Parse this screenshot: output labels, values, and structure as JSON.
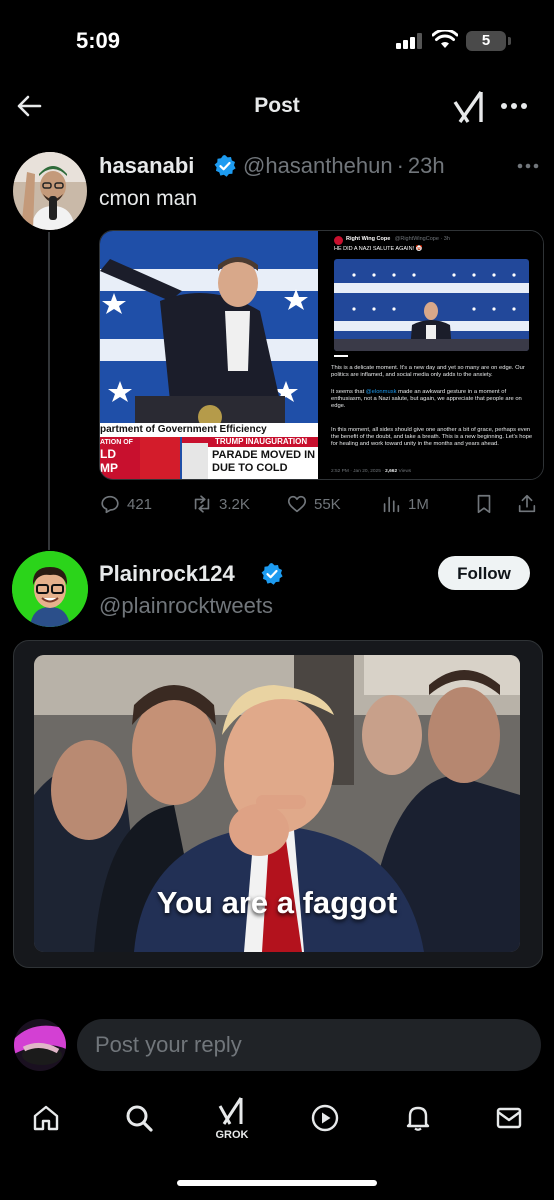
{
  "status": {
    "time": "5:09",
    "battery": "5"
  },
  "header": {
    "title": "Post"
  },
  "post1": {
    "name": "hasanabi",
    "handle": "@hasanthehun",
    "time": "23h",
    "separator": "·",
    "text": "cmon man",
    "media": {
      "chyron_top": "partment of Government Efficiency",
      "chyron_red": "TRUMP INAUGURATION",
      "chyron_main1": "PARADE MOVED IN",
      "chyron_main2": "DUE TO COLD",
      "chyron_left1": "ATION OF",
      "chyron_left2": "LD",
      "chyron_left3": "MP",
      "embed_account": "Right Wing Cope",
      "embed_handle": "@RightWingCope · 3h",
      "embed_title": "HE DID A NAZI SALUTE AGAIN! 🤡",
      "embed_p1": "This is a delicate moment. It's a new day and yet so many are on edge. Our politics are inflamed, and social media only adds to the anxiety.",
      "embed_p2a": "It seems that ",
      "embed_p2_mention": "@elonmusk",
      "embed_p2b": " made an awkward gesture in a moment of enthusiasm, not a Nazi salute, but again, we appreciate that people are on edge.",
      "embed_p3": "In this moment, all sides should give one another a bit of grace, perhaps even the benefit of the doubt, and take a breath. This is a new beginning. Let's hope for healing and work toward unity in the months and years ahead.",
      "embed_footer": "2:52 PM · Jan 20, 2025 · ",
      "embed_views": "2,662",
      "embed_views_label": " Views"
    },
    "actions": {
      "replies": "421",
      "reposts": "3.2K",
      "likes": "55K",
      "views": "1M"
    }
  },
  "post2": {
    "name": "Plainrock124",
    "handle": "@plainrocktweets",
    "follow_label": "Follow",
    "media_caption": "You are a faggot"
  },
  "reply": {
    "placeholder": "Post your reply"
  },
  "tabs": {
    "grok_label": "GROK"
  },
  "colors": {
    "verified": "#1d9bf0",
    "accent": "#1d9bf0",
    "background": "#000000",
    "muted": "#71767b"
  }
}
